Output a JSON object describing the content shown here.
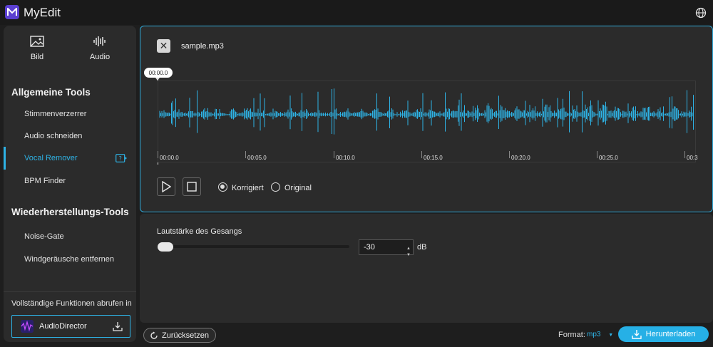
{
  "app": {
    "title": "MyEdit"
  },
  "modes": [
    {
      "label": "Bild",
      "icon": "image-icon"
    },
    {
      "label": "Audio",
      "icon": "audio-wave-icon"
    }
  ],
  "sidebar": {
    "section1_title": "Allgemeine Tools",
    "section1_items": [
      "Stimmenverzerrer",
      "Audio schneiden",
      "Vocal Remover",
      "BPM Finder"
    ],
    "active_item": "Vocal Remover",
    "section2_title": "Wiederherstellungs-Tools",
    "section2_items": [
      "Noise-Gate",
      "Windgeräusche entfernen"
    ],
    "promo_text": "Vollständige Funktionen abrufen in",
    "promo_button": "AudioDirector"
  },
  "player": {
    "filename": "sample.mp3",
    "current_time": "00:00.0",
    "ruler_labels": [
      "00:00.0",
      "00:05.0",
      "00:10.0",
      "00:15.0",
      "00:20.0",
      "00:25.0",
      "00:3"
    ],
    "radio_options": [
      "Korrigiert",
      "Original"
    ],
    "selected_option": "Korrigiert",
    "wave_color": "#2eb3e6"
  },
  "volume": {
    "label": "Lautstärke des Gesangs",
    "value": "-30",
    "unit": "dB",
    "slider_fraction": 0.0
  },
  "footer": {
    "reset_label": "Zurücksetzen",
    "format_label": "Format:",
    "format_value": "mp3",
    "download_label": "Herunterladen"
  },
  "colors": {
    "accent": "#2eb3e6",
    "brand": "#5b3fd1"
  }
}
